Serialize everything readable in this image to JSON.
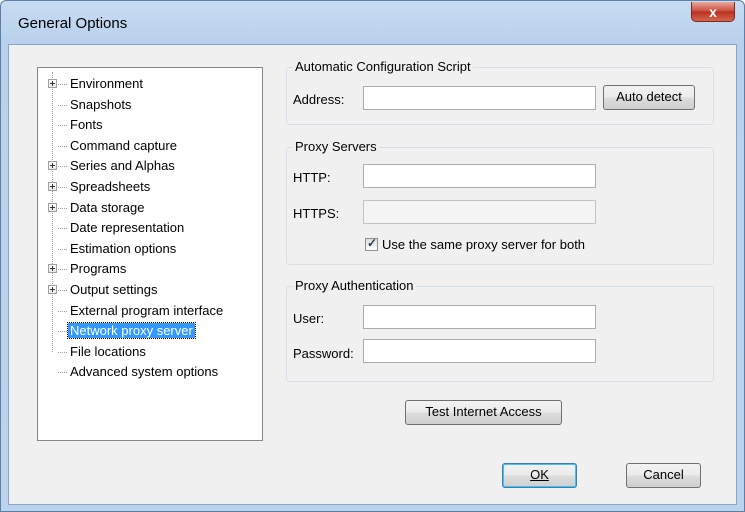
{
  "window": {
    "title": "General Options",
    "close_glyph": "x"
  },
  "tree": {
    "items": [
      {
        "label": "Environment",
        "expandable": true,
        "selected": false
      },
      {
        "label": "Snapshots",
        "expandable": false,
        "selected": false
      },
      {
        "label": "Fonts",
        "expandable": false,
        "selected": false
      },
      {
        "label": "Command capture",
        "expandable": false,
        "selected": false
      },
      {
        "label": "Series and Alphas",
        "expandable": true,
        "selected": false
      },
      {
        "label": "Spreadsheets",
        "expandable": true,
        "selected": false
      },
      {
        "label": "Data storage",
        "expandable": true,
        "selected": false
      },
      {
        "label": "Date representation",
        "expandable": false,
        "selected": false
      },
      {
        "label": "Estimation options",
        "expandable": false,
        "selected": false
      },
      {
        "label": "Programs",
        "expandable": true,
        "selected": false
      },
      {
        "label": "Output settings",
        "expandable": true,
        "selected": false
      },
      {
        "label": "External program interface",
        "expandable": false,
        "selected": false
      },
      {
        "label": "Network proxy server",
        "expandable": false,
        "selected": true
      },
      {
        "label": "File locations",
        "expandable": false,
        "selected": false
      },
      {
        "label": "Advanced system options",
        "expandable": false,
        "selected": false
      }
    ]
  },
  "auto_config": {
    "title": "Automatic Configuration Script",
    "address_label": "Address:",
    "address_value": "",
    "auto_detect_label": "Auto detect"
  },
  "proxy_servers": {
    "title": "Proxy Servers",
    "http_label": "HTTP:",
    "http_value": "",
    "https_label": "HTTPS:",
    "https_value": "",
    "same_proxy_label": "Use the same proxy server for both",
    "same_proxy_checked": true
  },
  "proxy_auth": {
    "title": "Proxy Authentication",
    "user_label": "User:",
    "user_value": "",
    "password_label": "Password:",
    "password_value": ""
  },
  "buttons": {
    "test_label": "Test Internet Access",
    "ok_label": "OK",
    "cancel_label": "Cancel"
  }
}
